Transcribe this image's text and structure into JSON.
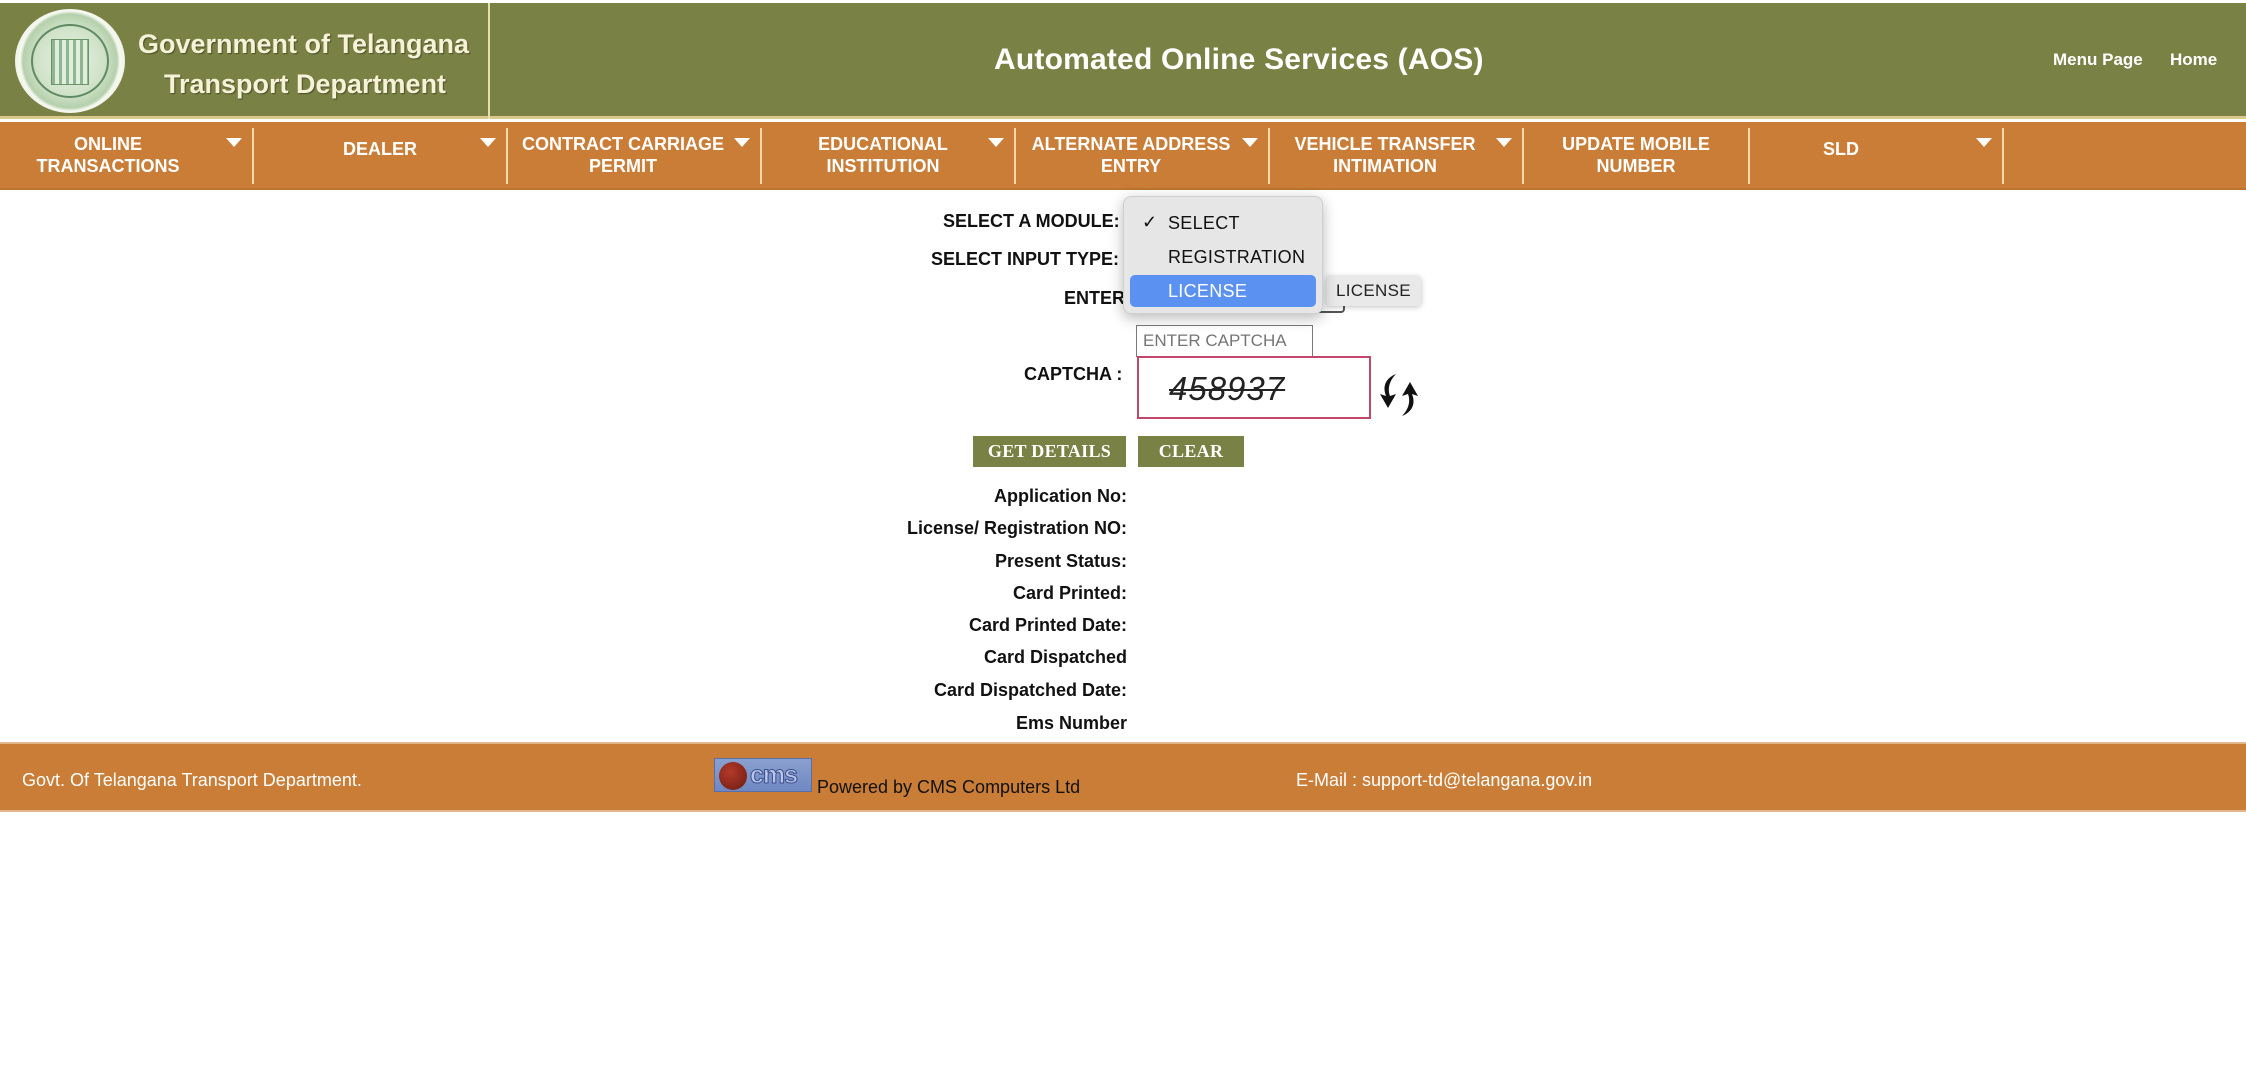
{
  "header": {
    "org_line1": "Government of Telangana",
    "org_line2": "Transport Department",
    "app_title": "Automated Online Services (AOS)",
    "links": {
      "menu_page": "Menu Page",
      "home": "Home"
    }
  },
  "nav": {
    "items": [
      {
        "label": "ONLINE TRANSACTIONS",
        "has_dropdown": true
      },
      {
        "label": "DEALER",
        "has_dropdown": true
      },
      {
        "label": "CONTRACT CARRIAGE PERMIT",
        "has_dropdown": true
      },
      {
        "label": "EDUCATIONAL INSTITUTION",
        "has_dropdown": true
      },
      {
        "label": "ALTERNATE ADDRESS ENTRY",
        "has_dropdown": true
      },
      {
        "label": "VEHICLE TRANSFER INTIMATION",
        "has_dropdown": true
      },
      {
        "label": "UPDATE MOBILE NUMBER",
        "has_dropdown": false
      },
      {
        "label": "SLD",
        "has_dropdown": true
      }
    ]
  },
  "form": {
    "module_label": "SELECT A MODULE:",
    "input_type_label": "SELECT INPUT TYPE:",
    "enter_label": "ENTER",
    "captcha_label": "CAPTCHA :",
    "captcha_placeholder": "ENTER CAPTCHA",
    "captcha_value": "",
    "captcha_image_text": "458937",
    "input_type_chip": "LICENSE",
    "module_dropdown": {
      "open": true,
      "checked": "SELECT",
      "highlighted": "LICENSE",
      "options": [
        "SELECT",
        "REGISTRATION",
        "LICENSE"
      ]
    },
    "buttons": {
      "get_details": "GET DETAILS",
      "clear": "CLEAR"
    }
  },
  "details": {
    "labels": [
      "Application No:",
      "License/ Registration NO:",
      "Present Status:",
      "Card Printed:",
      "Card Printed Date:",
      "Card Dispatched",
      "Card Dispatched Date:",
      "Ems Number"
    ]
  },
  "footer": {
    "left_text": "Govt. Of Telangana Transport Department.",
    "vendor_logo_text": "cms",
    "powered_by": "Powered by CMS Computers Ltd",
    "email": "E-Mail : support-td@telangana.gov.in"
  },
  "colors": {
    "header_bg": "#7a8145",
    "nav_bg": "#c97d37",
    "button_bg": "#7a8145",
    "dropdown_highlight": "#5b92f2",
    "captcha_border": "#c3476a"
  }
}
